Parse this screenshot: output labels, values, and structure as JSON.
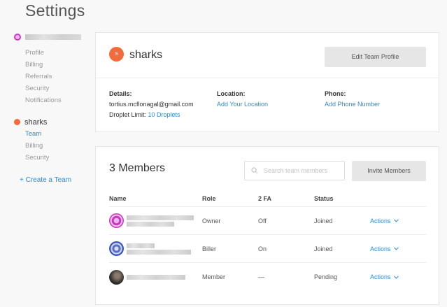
{
  "page": {
    "title": "Settings"
  },
  "sidebar": {
    "account_links": [
      "Profile",
      "Billing",
      "Referrals",
      "Security",
      "Notifications"
    ],
    "team": {
      "name": "sharks",
      "links": [
        "Team",
        "Billing",
        "Security"
      ],
      "active": "Team"
    },
    "create_team": "+ Create a Team"
  },
  "team_card": {
    "badge_letter": "S",
    "name": "sharks",
    "edit_button": "Edit Team Profile",
    "details_label": "Details:",
    "email": "tortius.mcflonagal@gmail.com",
    "droplet_limit_label": "Droplet Limit:",
    "droplet_limit_value": "10 Droplets",
    "location_label": "Location:",
    "location_link": "Add Your Location",
    "phone_label": "Phone:",
    "phone_link": "Add Phone Number"
  },
  "members_card": {
    "title": "3 Members",
    "search_placeholder": "Search team members",
    "invite_button": "Invite Members",
    "columns": [
      "Name",
      "Role",
      "2 FA",
      "Status",
      ""
    ],
    "rows": [
      {
        "avatar": "pink-identicon",
        "role": "Owner",
        "twofa": "Off",
        "status": "Joined",
        "action": "Actions"
      },
      {
        "avatar": "blue-identicon",
        "role": "Biller",
        "twofa": "On",
        "status": "Joined",
        "action": "Actions"
      },
      {
        "avatar": "photo-avatar",
        "role": "Member",
        "twofa": "—",
        "status": "Pending",
        "action": "Actions"
      }
    ]
  },
  "colors": {
    "accent": "#2c8bd8",
    "team_badge": "#f26b3a",
    "button_grey": "#e6e6e6"
  }
}
